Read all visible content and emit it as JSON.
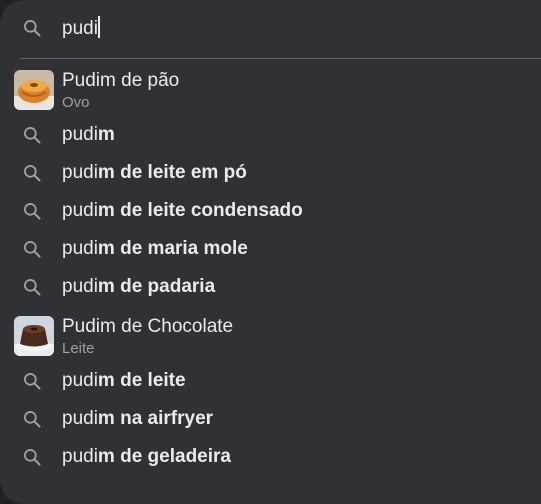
{
  "search": {
    "value": "pudi"
  },
  "suggestions": [
    {
      "kind": "rich",
      "title": "Pudim de pão",
      "subtitle": "Ovo",
      "thumb": "pudim-de-pao"
    },
    {
      "kind": "query",
      "prefix": "pudi",
      "bold": "m"
    },
    {
      "kind": "query",
      "prefix": "pudi",
      "bold": "m de leite em pó"
    },
    {
      "kind": "query",
      "prefix": "pudi",
      "bold": "m de leite condensado"
    },
    {
      "kind": "query",
      "prefix": "pudi",
      "bold": "m de maria mole"
    },
    {
      "kind": "query",
      "prefix": "pudi",
      "bold": "m de padaria"
    },
    {
      "kind": "rich",
      "title": "Pudim de Chocolate",
      "subtitle": "Leite",
      "thumb": "pudim-de-chocolate"
    },
    {
      "kind": "query",
      "prefix": "pudi",
      "bold": "m de leite"
    },
    {
      "kind": "query",
      "prefix": "pudi",
      "bold": "m na airfryer"
    },
    {
      "kind": "query",
      "prefix": "pudi",
      "bold": "m de geladeira"
    }
  ],
  "icons": {
    "search": "search-icon"
  },
  "colors": {
    "background": "#303134",
    "text": "#e8eaed",
    "subtext": "#9aa0a6",
    "icon": "#9aa0a6"
  }
}
